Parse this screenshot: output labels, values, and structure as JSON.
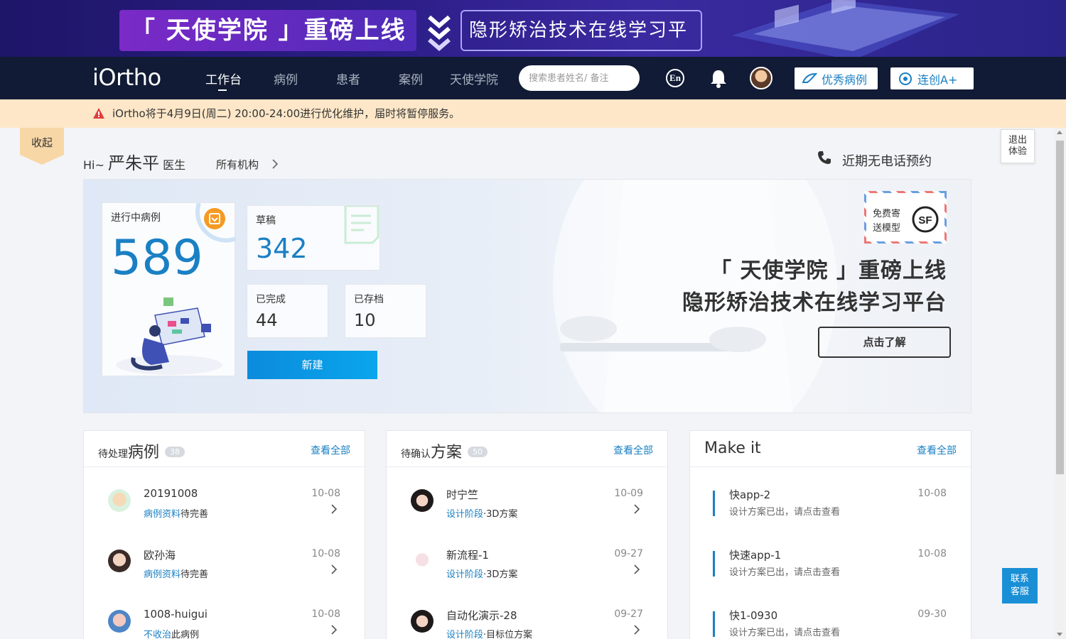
{
  "promo": {
    "left_text": "「 天使学院 」重磅上线",
    "right_text": "隐形矫治技术在线学习平台"
  },
  "nav": {
    "logo": "iOrtho",
    "items": [
      {
        "label": "工作台",
        "active": true
      },
      {
        "label": "病例",
        "active": false
      },
      {
        "label": "患者",
        "active": false
      },
      {
        "label": "案例",
        "active": false
      },
      {
        "label": "天使学院",
        "active": false
      }
    ],
    "search_placeholder": "搜索患者姓名/ 备注",
    "lang_label": "En",
    "btn_excellent": "优秀病例",
    "btn_lianchuang": "连创A+"
  },
  "notice": {
    "text": "iOrtho将于4月9日(周二) 20:00-24:00进行优化维护，届时将暂停服务。"
  },
  "sidebar": {
    "collapse_label": "收起",
    "exit_line1": "退出",
    "exit_line2": "体验"
  },
  "greeting": {
    "prefix": "Hi~",
    "name": "严朱平",
    "title": "医生",
    "org": "所有机构",
    "phone_text": "近期无电话预约"
  },
  "stats": {
    "in_progress_label": "进行中病例",
    "in_progress_value": "589",
    "draft_label": "草稿",
    "draft_value": "342",
    "completed_label": "已完成",
    "completed_value": "44",
    "archived_label": "已存档",
    "archived_value": "10",
    "new_button": "新建"
  },
  "hero": {
    "sf_line1": "免费寄",
    "sf_line2": "送模型",
    "sf_logo": "SF",
    "title1": "「 天使学院 」重磅上线",
    "title2": "隐形矫治技术在线学习平台",
    "learn_button": "点击了解"
  },
  "pending_cases": {
    "title_small": "待处理",
    "title_big": "病例",
    "badge": "38",
    "view_all": "查看全部",
    "rows": [
      {
        "name": "20191008",
        "status_link": "病例资料",
        "status_text": "待完善",
        "date": "10-08"
      },
      {
        "name": "欧孙海",
        "status_link": "病例资料",
        "status_text": "待完善",
        "date": "10-08"
      },
      {
        "name": "1008-huigui",
        "status_link": "不收治",
        "status_text": "此病例",
        "date": "10-08"
      }
    ]
  },
  "pending_plans": {
    "title_small": "待确认",
    "title_big": "方案",
    "badge": "50",
    "view_all": "查看全部",
    "rows": [
      {
        "name": "时宁竺",
        "status_link": "设计阶段",
        "status_text": "·3D方案",
        "date": "10-09"
      },
      {
        "name": "新流程-1",
        "status_link": "设计阶段",
        "status_text": "·3D方案",
        "date": "09-27"
      },
      {
        "name": "自动化演示-28",
        "status_link": "设计阶段",
        "status_text": "·目标位方案",
        "date": "09-27"
      }
    ]
  },
  "make_it": {
    "title": "Make it",
    "view_all": "查看全部",
    "rows": [
      {
        "name": "快app-2",
        "sub": "设计方案已出，请点击查看",
        "date": "10-08"
      },
      {
        "name": "快速app-1",
        "sub": "设计方案已出，请点击查看",
        "date": "10-08"
      },
      {
        "name": "快1-0930",
        "sub": "设计方案已出，请点击查看",
        "date": "09-30"
      }
    ]
  },
  "contact": {
    "line1": "联系",
    "line2": "客服"
  },
  "colors": {
    "nav_bg": "#111b35",
    "accent_blue": "#1a80c4",
    "notice_bg": "#fde7c8",
    "warning_red": "#e03c3c"
  }
}
